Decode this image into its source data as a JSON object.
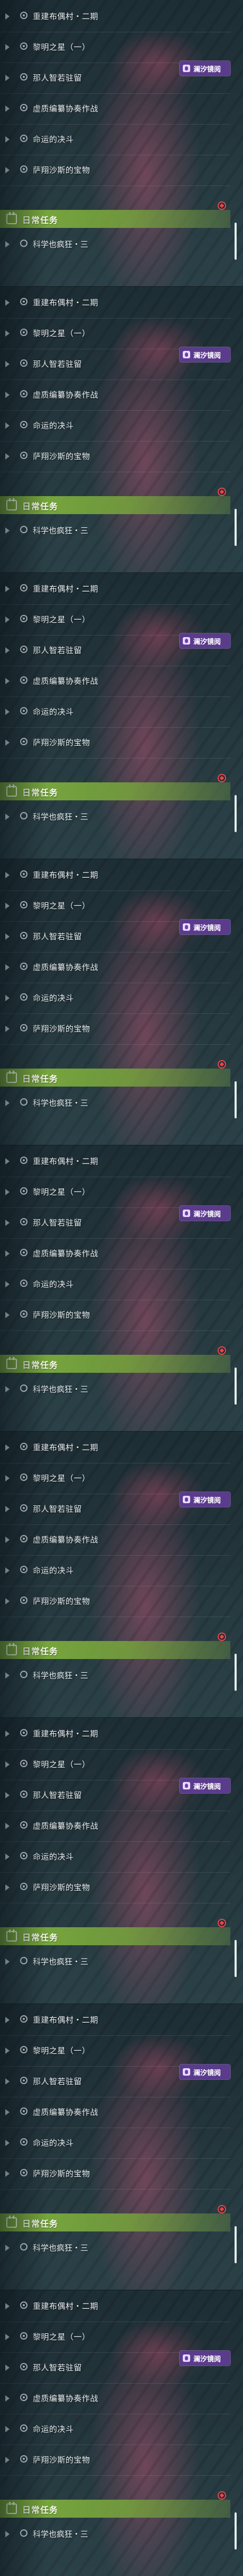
{
  "quests": [
    "重建布偶村・二期",
    "黎明之星（一）",
    "那人智若驻留",
    "虚质编纂协奏作战",
    "命运的决斗",
    "萨翔沙斯的宝物"
  ],
  "badge": {
    "label": "澜汐镜阅",
    "icon": "badge-emblem-icon",
    "color": "#5b3b8c"
  },
  "daily": {
    "label": "日常任务",
    "icon": "calendar-icon",
    "color": "#82b43c"
  },
  "daily_quest": "科学也疯狂・三",
  "marker": {
    "icon": "location-marker-icon",
    "color": "#e5484d"
  },
  "panel_count": 9
}
